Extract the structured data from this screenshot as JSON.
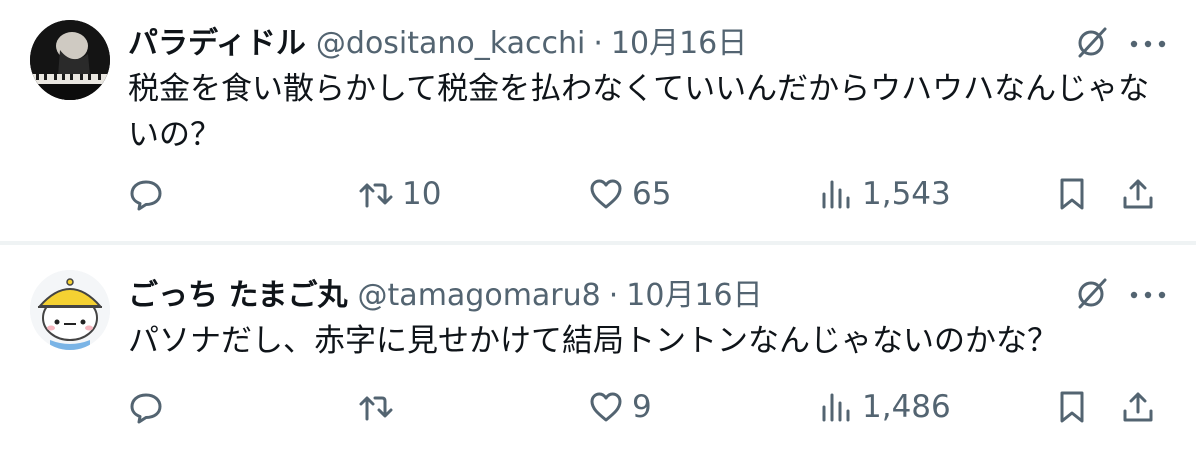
{
  "tweets": [
    {
      "display_name": "パラディドル",
      "handle": "@dositano_kacchi",
      "separator": "·",
      "date": "10月16日",
      "text": "税金を食い散らかして税金を払わなくていいんだからウハウハなんじゃないの？",
      "retweets": "10",
      "likes": "65",
      "views": "1,543",
      "avatar_icon": "pianist-photo"
    },
    {
      "display_name": "ごっち たまご丸",
      "handle": "@tamagomaru8",
      "separator": "·",
      "date": "10月16日",
      "text": "パソナだし、赤字に見せかけて結局トントンなんじゃないのかな？",
      "retweets": "",
      "likes": "9",
      "views": "1,486",
      "avatar_icon": "yellow-hat-character"
    }
  ],
  "colors": {
    "text_primary": "#0f1419",
    "text_secondary": "#536471",
    "divider": "#eff3f4"
  }
}
